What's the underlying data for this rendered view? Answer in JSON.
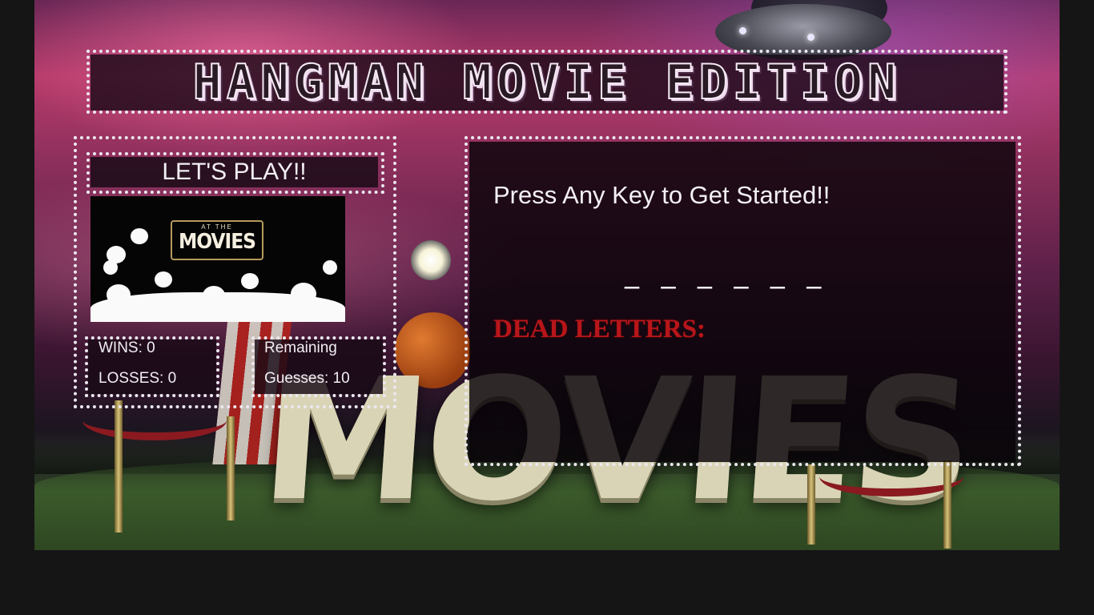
{
  "title": "HANGMAN MOVIE EDITION",
  "left_panel": {
    "heading": "LET'S PLAY!!",
    "poster": {
      "at_the": "AT THE",
      "movies": "MOVIES"
    },
    "stats": {
      "wins_label": "WINS: 0",
      "losses_label": "LOSSES: 0"
    },
    "remaining": {
      "line1": "Remaining",
      "line2": "Guesses: 10"
    }
  },
  "game_panel": {
    "prompt": "Press Any Key to Get Started!!",
    "word_blanks": "_ _ _ _ _ _",
    "dead_letters_label": "DEAD LETTERS:"
  },
  "colors": {
    "dead_letters": "#b8161a",
    "panel_text": "#f4f0f5"
  }
}
